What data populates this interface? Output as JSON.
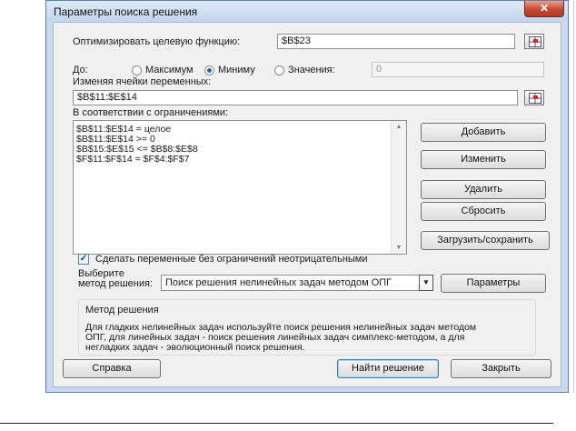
{
  "window": {
    "title": "Параметры поиска решения",
    "close_icon": "close-icon"
  },
  "objective": {
    "label": "Оптимизировать целевую функцию:",
    "value": "$B$23"
  },
  "target": {
    "label": "До:",
    "options": [
      {
        "label": "Максимум",
        "checked": false
      },
      {
        "label": "Миниму",
        "checked": true
      },
      {
        "label": "Значения:",
        "checked": false
      }
    ],
    "value": "0"
  },
  "variables": {
    "label": "Изменяя ячейки переменных:",
    "value": "$B$11:$E$14"
  },
  "constraints": {
    "label": "В соответствии с ограничениями:",
    "items": [
      "$B$11:$E$14 = целое",
      "$B$11:$E$14 >= 0",
      "$B$15:$E$15 <= $B$8:$E$8",
      "$F$11:$F$14 = $F$4:$F$7"
    ]
  },
  "buttons": {
    "add": "Добавить",
    "change": "Изменить",
    "delete": "Удалить",
    "reset": "Сбросить",
    "load_save": "Загрузить/сохранить",
    "options": "Параметры",
    "help": "Справка",
    "solve": "Найти решение",
    "close": "Закрыть"
  },
  "nonnegative": {
    "label": "Сделать переменные без ограничений неотрицательными",
    "checked": true
  },
  "method": {
    "label_line1": "Выберите",
    "label_line2": "метод решения:",
    "value": "Поиск решения нелинейных задач методом ОПГ"
  },
  "method_info": {
    "title": "Метод решения",
    "lines": [
      "Для гладких нелинейных задач используйте поиск решения нелинейных задач методом",
      "ОПГ, для линейных задач - поиск решения линейных задач симплекс-методом, а для",
      "негладких задач - эволюционный поиск решения."
    ]
  },
  "colors": {
    "frame": "#c9d9ee",
    "client": "#f0f0f0",
    "close": "#c44b31",
    "accent": "#3c7fb1"
  }
}
